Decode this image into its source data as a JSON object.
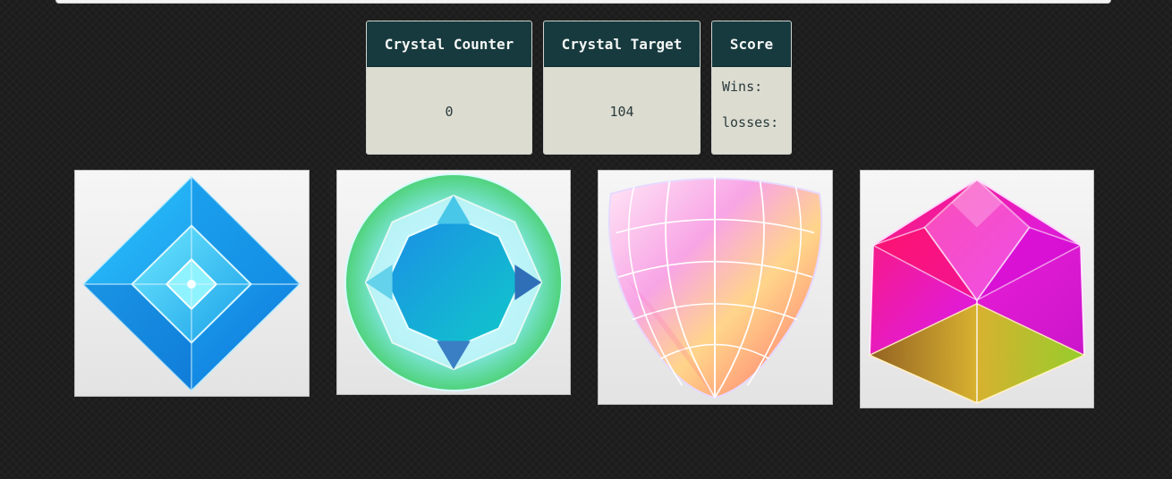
{
  "counter": {
    "label": "Crystal Counter",
    "value": "0"
  },
  "target": {
    "label": "Crystal Target",
    "value": "104"
  },
  "score": {
    "label": "Score",
    "wins_label": "Wins:",
    "losses_label": "losses:"
  },
  "crystals": [
    {
      "name": "blue-diamond-crystal",
      "color": "#1aa7e6"
    },
    {
      "name": "aqua-round-crystal",
      "color": "#27c3d8"
    },
    {
      "name": "pink-pear-crystal",
      "color": "#f59ad6"
    },
    {
      "name": "magenta-cube-crystal",
      "color": "#e3148c"
    }
  ],
  "colors": {
    "background": "#1c1c1c",
    "panel_header": "#173a3e",
    "panel_body": "#dcdcd1"
  }
}
